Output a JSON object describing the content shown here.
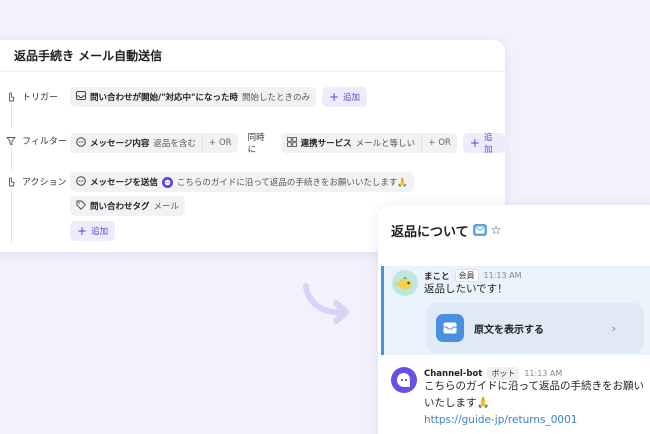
{
  "automation": {
    "title": "返品手続き メール自動送信",
    "trigger": {
      "label": "トリガー",
      "chip_main": "問い合わせが開始/\"対応中\"になった時",
      "chip_sub": "開始したときのみ",
      "add_label": "追加"
    },
    "filter": {
      "label": "フィルター",
      "chip1_main": "メッセージ内容",
      "chip1_sub": "返品を含む",
      "or_label": "OR",
      "joiner": "同時に",
      "chip2_main": "連携サービス",
      "chip2_sub": "メールと等しい",
      "add_label": "追加"
    },
    "action": {
      "label": "アクション",
      "chip1_main": "メッセージを送信",
      "chip1_sub": "こちらのガイドに沿って返品の手続きをお願いいたします🙏",
      "chip2_main": "問い合わせタグ",
      "chip2_sub": "メール",
      "add_label": "追加"
    }
  },
  "chat": {
    "title": "返品について",
    "user_message": {
      "name": "まこと",
      "badge": "会員",
      "time": "11:13 AM",
      "text": "返品したいです！",
      "original_button": "原文を表示する"
    },
    "bot_message": {
      "name": "Channel-bot",
      "badge": "ボット",
      "time": "11:13 AM",
      "text_line1": "こちらのガイドに沿って返品の手続きをお願い",
      "text_line2": "いたします🙏",
      "link": "https://guide-jp/returns_0001"
    }
  },
  "colors": {
    "accent": "#5a47d6",
    "chat_blue": "#4a90e2",
    "background": "#f3f1fb"
  }
}
